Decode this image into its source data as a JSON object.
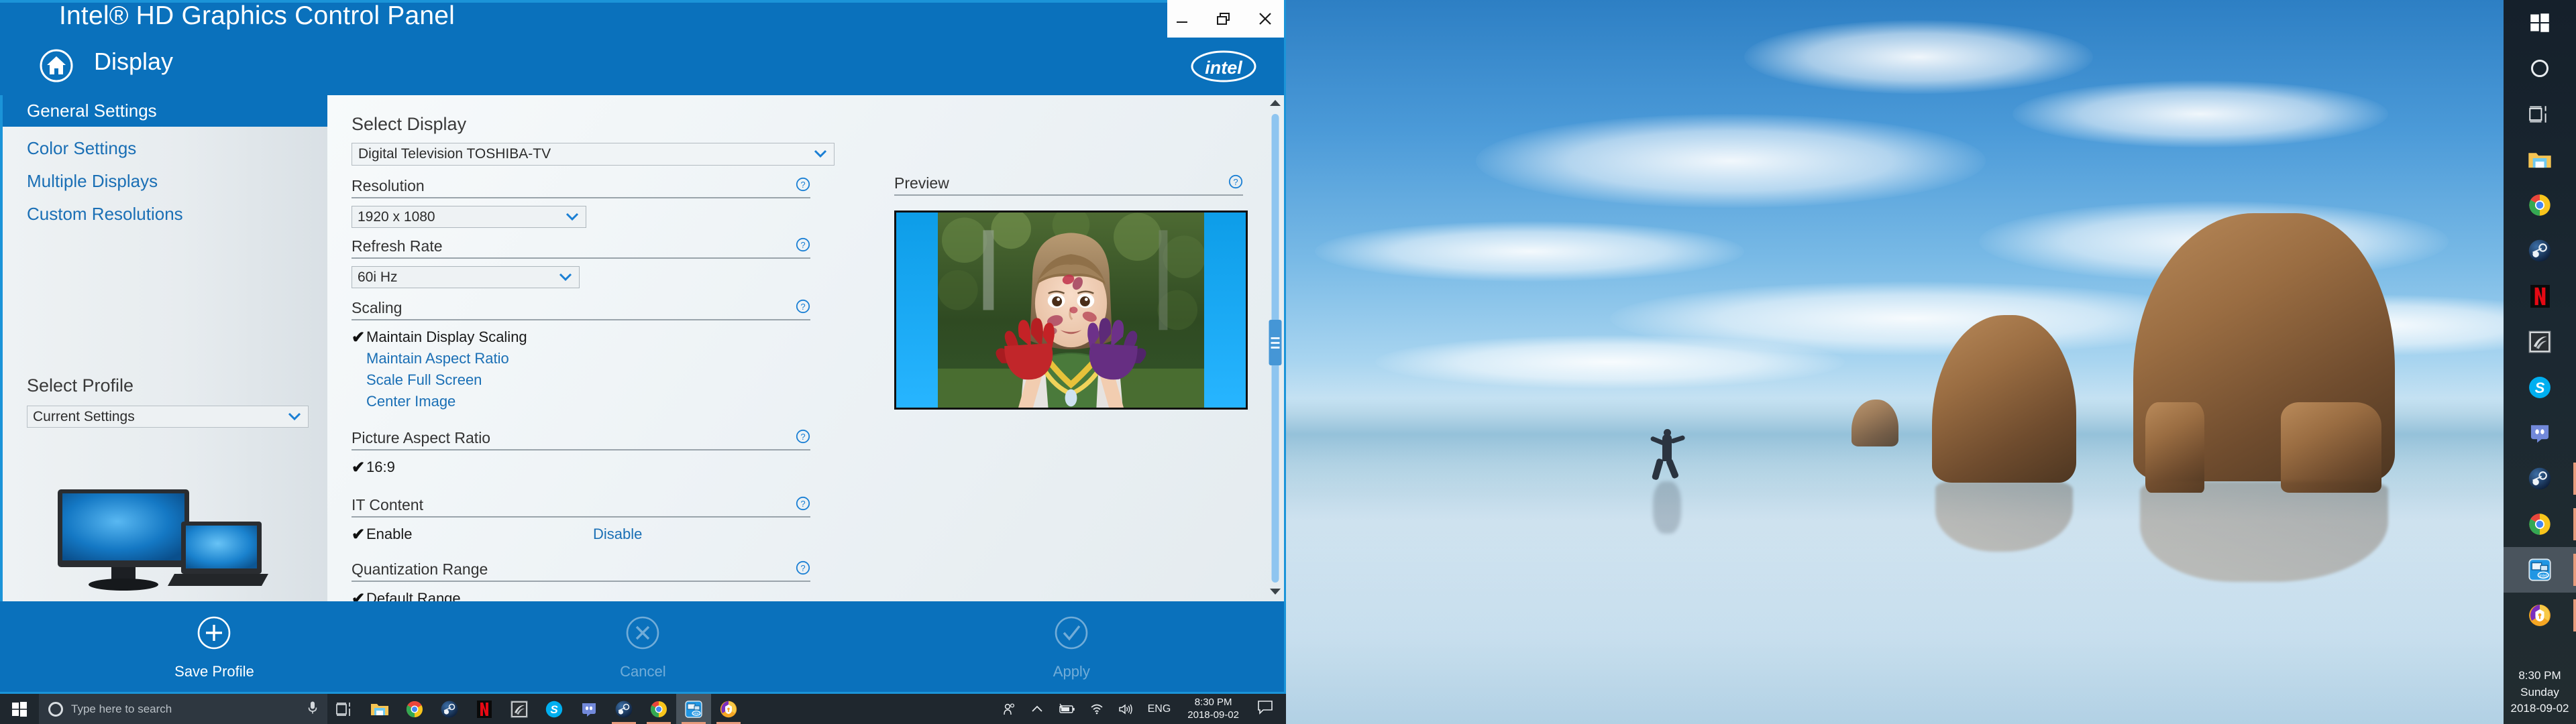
{
  "window": {
    "title": "Intel® HD Graphics Control Panel",
    "breadcrumb": "Display",
    "home_icon": "home-icon",
    "brand_logo": "intel-logo",
    "controls": {
      "minimize": "minimize-icon",
      "restore": "restore-icon",
      "close": "close-icon"
    }
  },
  "sidebar": {
    "items": [
      {
        "label": "General Settings",
        "active": true
      },
      {
        "label": "Color Settings",
        "active": false
      },
      {
        "label": "Multiple Displays",
        "active": false
      },
      {
        "label": "Custom Resolutions",
        "active": false
      }
    ],
    "profile": {
      "label": "Select Profile",
      "value": "Current Settings"
    },
    "artwork": "dual-monitor-illustration"
  },
  "main": {
    "select_display": {
      "label": "Select Display",
      "value": "Digital Television TOSHIBA-TV"
    },
    "sections": [
      {
        "id": "resolution",
        "label": "Resolution",
        "help": "help-icon",
        "control": "combo",
        "value": "1920 x 1080"
      },
      {
        "id": "refresh-rate",
        "label": "Refresh Rate",
        "help": "help-icon",
        "control": "combo",
        "value": "60i Hz"
      },
      {
        "id": "scaling",
        "label": "Scaling",
        "help": "help-icon",
        "control": "options",
        "options": [
          {
            "label": "Maintain Display Scaling",
            "selected": true
          },
          {
            "label": "Maintain Aspect Ratio",
            "selected": false
          },
          {
            "label": "Scale Full Screen",
            "selected": false
          },
          {
            "label": "Center Image",
            "selected": false
          }
        ]
      },
      {
        "id": "picture-aspect-ratio",
        "label": "Picture Aspect Ratio",
        "help": "help-icon",
        "control": "options",
        "options": [
          {
            "label": "16:9",
            "selected": true
          }
        ]
      },
      {
        "id": "it-content",
        "label": "IT Content",
        "help": "help-icon",
        "control": "options-inline",
        "options": [
          {
            "label": "Enable",
            "selected": true
          },
          {
            "label": "Disable",
            "selected": false
          }
        ]
      },
      {
        "id": "quantization-range",
        "label": "Quantization Range",
        "help": "help-icon",
        "control": "options",
        "options": [
          {
            "label": "Default Range",
            "selected": true
          }
        ]
      }
    ],
    "preview": {
      "label": "Preview",
      "help": "help-icon",
      "image": "girl-with-painted-hands-preview"
    },
    "scrollbar": {
      "up_arrow": "scroll-up-arrow-icon",
      "down_arrow": "scroll-down-arrow-icon"
    }
  },
  "actions": [
    {
      "id": "save-profile",
      "label": "Save Profile",
      "icon": "plus-circle-icon",
      "enabled": true
    },
    {
      "id": "cancel",
      "label": "Cancel",
      "icon": "x-circle-icon",
      "enabled": false
    },
    {
      "id": "apply",
      "label": "Apply",
      "icon": "check-circle-icon",
      "enabled": false
    }
  ],
  "taskbar": {
    "start": "windows-start-icon",
    "search": {
      "placeholder": "Type here to search",
      "cortana_icon": "cortana-ring-icon",
      "mic_icon": "microphone-icon"
    },
    "task_view": "task-view-icon",
    "pinned": [
      {
        "name": "file-explorer-icon",
        "label": "File Explorer",
        "active": false
      },
      {
        "name": "chrome-icon",
        "label": "Google Chrome",
        "active": false
      },
      {
        "name": "steam-icon",
        "label": "Steam",
        "active": false
      },
      {
        "name": "netflix-icon",
        "label": "Netflix",
        "active": false
      },
      {
        "name": "geforce-experience-icon",
        "label": "GeForce Experience",
        "active": false
      },
      {
        "name": "skype-icon",
        "label": "Skype",
        "active": false
      },
      {
        "name": "discord-icon",
        "label": "Discord",
        "active": false
      },
      {
        "name": "steam-running-icon",
        "label": "Steam",
        "active": false
      },
      {
        "name": "chrome-running-icon",
        "label": "Google Chrome",
        "active": false
      },
      {
        "name": "intel-graphics-icon",
        "label": "Intel HD Graphics Control Panel",
        "active": true
      },
      {
        "name": "avast-icon",
        "label": "Avast",
        "active": false
      }
    ],
    "tray": {
      "people_icon": "people-icon",
      "overflow_icon": "show-hidden-icons-chevron",
      "battery_icon": "battery-charging-icon",
      "network_icon": "wifi-icon",
      "volume_icon": "speaker-icon",
      "language": "ENG"
    },
    "clock": {
      "time": "8:30 PM",
      "date": "2018-09-02"
    },
    "notifications_icon": "action-center-icon"
  },
  "right_taskbar": {
    "start": "windows-start-icon",
    "cortana": "cortana-ring-icon",
    "task_view": "task-view-icon",
    "pinned": [
      {
        "name": "file-explorer-icon",
        "label": "File Explorer",
        "active": false
      },
      {
        "name": "chrome-icon",
        "label": "Google Chrome",
        "active": false
      },
      {
        "name": "steam-icon",
        "label": "Steam",
        "active": false
      },
      {
        "name": "netflix-icon",
        "label": "Netflix",
        "active": false
      },
      {
        "name": "geforce-experience-icon",
        "label": "GeForce Experience",
        "active": false
      },
      {
        "name": "skype-icon",
        "label": "Skype",
        "active": false
      },
      {
        "name": "discord-icon",
        "label": "Discord",
        "active": false
      },
      {
        "name": "steam-running-icon",
        "label": "Steam",
        "active": false
      },
      {
        "name": "chrome-running-icon",
        "label": "Google Chrome",
        "active": false
      },
      {
        "name": "intel-graphics-icon",
        "label": "Intel HD Graphics Control Panel",
        "active": true
      },
      {
        "name": "avast-icon",
        "label": "Avast",
        "active": false
      }
    ],
    "clock": {
      "time": "8:30 PM",
      "weekday": "Sunday",
      "date": "2018-09-02"
    }
  },
  "colors": {
    "intel_blue": "#0a71bc",
    "accent_cyan": "#1b94d8",
    "link_blue": "#1a6fb5",
    "taskbar_dark": "#1f272e"
  }
}
